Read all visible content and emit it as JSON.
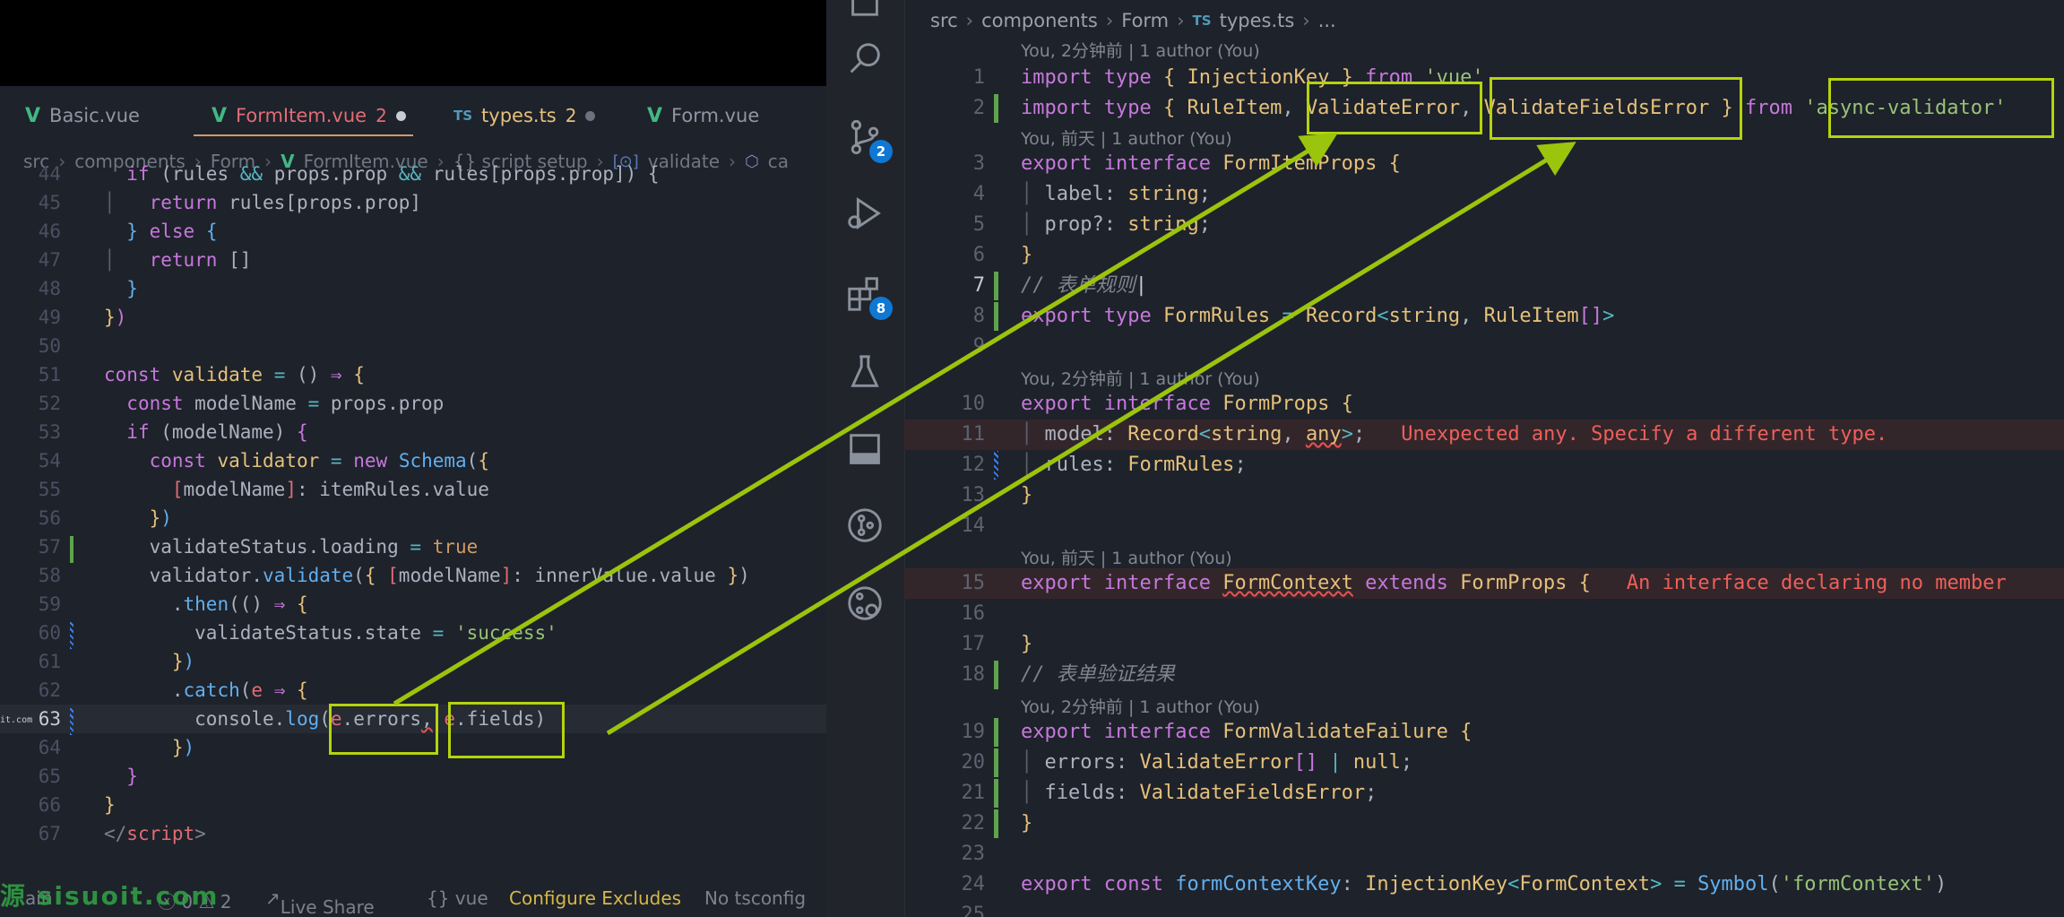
{
  "left": {
    "tabs": [
      {
        "label": "Basic.vue",
        "icon": "vue-icon",
        "badge": "",
        "state": "normal"
      },
      {
        "label": "FormItem.vue",
        "icon": "vue-icon",
        "badge": "2",
        "state": "active"
      },
      {
        "label": "types.ts",
        "icon": "ts-icon",
        "badge": "2",
        "state": "modified"
      },
      {
        "label": "Form.vue",
        "icon": "vue-icon",
        "badge": "",
        "state": "normal"
      }
    ],
    "breadcrumb": [
      "src",
      "components",
      "Form",
      "FormItem.vue",
      "{} script setup",
      "validate",
      "ca"
    ],
    "lines": [
      {
        "n": "44"
      },
      {
        "n": "45"
      },
      {
        "n": "46"
      },
      {
        "n": "47"
      },
      {
        "n": "48"
      },
      {
        "n": "49"
      },
      {
        "n": "50"
      },
      {
        "n": "51"
      },
      {
        "n": "52"
      },
      {
        "n": "53"
      },
      {
        "n": "54"
      },
      {
        "n": "55"
      },
      {
        "n": "56"
      },
      {
        "n": "57"
      },
      {
        "n": "58"
      },
      {
        "n": "59"
      },
      {
        "n": "60"
      },
      {
        "n": "61"
      },
      {
        "n": "62"
      },
      {
        "n": "63"
      },
      {
        "n": "64"
      },
      {
        "n": "65"
      },
      {
        "n": "66"
      },
      {
        "n": "67"
      }
    ],
    "status": {
      "branch": "ain",
      "problems": "ⓧ 0 ⚠ 2",
      "live_share": "Live Share",
      "language": "{}  vue",
      "configure": "Configure Excludes",
      "tsconfig": "No tsconfig"
    },
    "watermark": "源 sisuoit.com",
    "mini_watermark": "it.com"
  },
  "right": {
    "breadcrumb": [
      "src",
      "components",
      "Form",
      "types.ts",
      "..."
    ],
    "activity_badges": {
      "scm": "2",
      "extensions": "8"
    },
    "lens": {
      "l1": "You, 2分钟前 | 1 author (You)",
      "l3": "You, 前天 | 1 author (You)",
      "l10": "You, 2分钟前 | 1 author (You)",
      "l15": "You, 前天 | 1 author (You)",
      "l19": "You, 2分钟前 | 1 author (You)"
    },
    "diagnostics": {
      "l11": "Unexpected any. Specify a different type.",
      "l15": "An interface declaring no member"
    },
    "line_numbers": [
      "1",
      "2",
      "3",
      "4",
      "5",
      "6",
      "7",
      "8",
      "9",
      "10",
      "11",
      "12",
      "13",
      "14",
      "15",
      "16",
      "17",
      "18",
      "19",
      "20",
      "21",
      "22",
      "23",
      "24",
      "25"
    ]
  },
  "colors": {
    "accent_highlight": "#b5d30f",
    "arrow": "#9bc40c",
    "error": "#ee5f5b"
  }
}
